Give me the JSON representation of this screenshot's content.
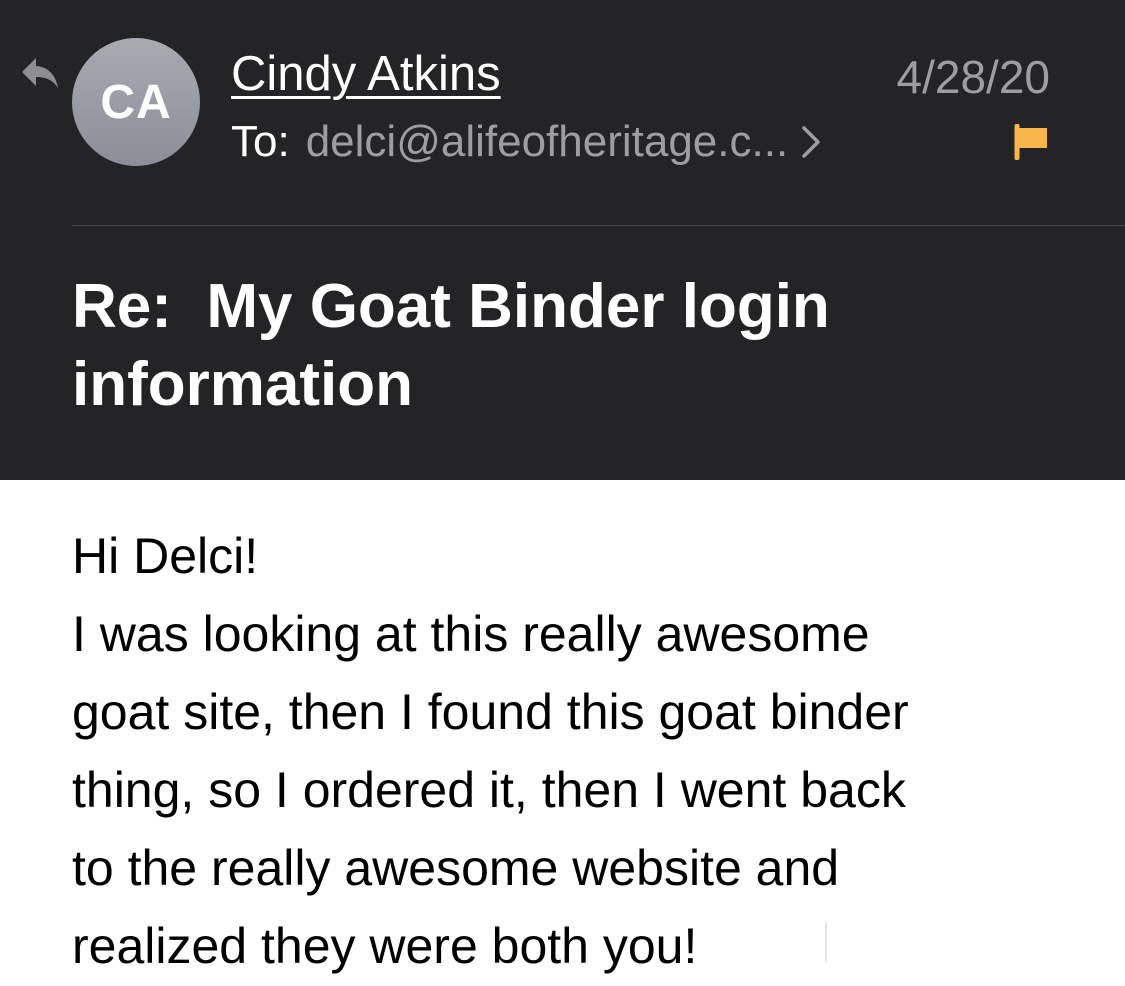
{
  "header": {
    "avatar_initials": "CA",
    "sender_name": "Cindy Atkins",
    "date": "4/28/20",
    "to_label": "To:",
    "to_address": "delci@alifeofheritage.c...",
    "subject": "Re:  My Goat Binder login information",
    "flag_color": "#f7b54a"
  },
  "body": {
    "lines": [
      "Hi Delci!",
      "I was looking at this really awesome",
      "goat site, then I found this goat binder",
      "thing, so I ordered it, then I went back",
      "to the really awesome website and",
      "realized they were both you!"
    ]
  },
  "icons": {
    "reply": "reply-icon",
    "chevron": "chevron-right-icon",
    "flag": "flag-icon"
  }
}
